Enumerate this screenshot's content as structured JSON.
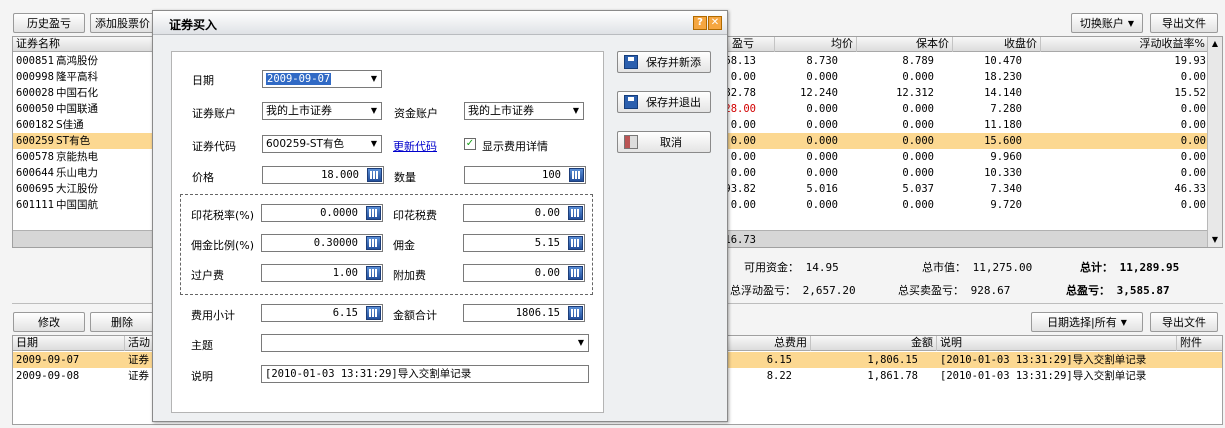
{
  "toolbar": {
    "history_btn": "历史盈亏",
    "add_stock_btn": "添加股票价",
    "switch_account_btn": "切换账户",
    "export_btn": "导出文件"
  },
  "holdings": {
    "columns": [
      "证券名称",
      "盈亏",
      "均价",
      "保本价",
      "收盘价",
      "浮动收益率%"
    ],
    "rows": [
      {
        "code": "000851",
        "name": "高鸿股份",
        "pl": "68.13",
        "avg": "8.730",
        "breakeven": "8.789",
        "close": "10.470",
        "ratio": "19.93",
        "selected": false,
        "negative": false
      },
      {
        "code": "000998",
        "name": "隆平高科",
        "pl": "0.00",
        "avg": "0.000",
        "breakeven": "0.000",
        "close": "18.230",
        "ratio": "0.00",
        "selected": false,
        "negative": false
      },
      {
        "code": "600028",
        "name": "中国石化",
        "pl": "82.78",
        "avg": "12.240",
        "breakeven": "12.312",
        "close": "14.140",
        "ratio": "15.52",
        "selected": false,
        "negative": false
      },
      {
        "code": "600050",
        "name": "中国联通",
        "pl": "28.00",
        "avg": "0.000",
        "breakeven": "0.000",
        "close": "7.280",
        "ratio": "0.00",
        "selected": false,
        "negative": true
      },
      {
        "code": "600182",
        "name": "S佳通",
        "pl": "0.00",
        "avg": "0.000",
        "breakeven": "0.000",
        "close": "11.180",
        "ratio": "0.00",
        "selected": false,
        "negative": false
      },
      {
        "code": "600259",
        "name": "ST有色",
        "pl": "0.00",
        "avg": "0.000",
        "breakeven": "0.000",
        "close": "15.600",
        "ratio": "0.00",
        "selected": true,
        "negative": false
      },
      {
        "code": "600578",
        "name": "京能热电",
        "pl": "0.00",
        "avg": "0.000",
        "breakeven": "0.000",
        "close": "9.960",
        "ratio": "0.00",
        "selected": false,
        "negative": false
      },
      {
        "code": "600644",
        "name": "乐山电力",
        "pl": "0.00",
        "avg": "0.000",
        "breakeven": "0.000",
        "close": "10.330",
        "ratio": "0.00",
        "selected": false,
        "negative": false
      },
      {
        "code": "600695",
        "name": "大江股份",
        "pl": "93.82",
        "avg": "5.016",
        "breakeven": "5.037",
        "close": "7.340",
        "ratio": "46.33",
        "selected": false,
        "negative": false
      },
      {
        "code": "601111",
        "name": "中国国航",
        "pl": "0.00",
        "avg": "0.000",
        "breakeven": "0.000",
        "close": "9.720",
        "ratio": "0.00",
        "selected": false,
        "negative": false
      }
    ],
    "footer_pl": "16.73"
  },
  "summary": {
    "available_label": "可用资金：",
    "available_value": "14.95",
    "market_value_label": "总市值：",
    "market_value_value": "11,275.00",
    "total_label": "总计：",
    "total_value": "11,289.95",
    "float_pl_label": "总浮动盈亏：",
    "float_pl_value": "2,657.20",
    "trade_pl_label": "总买卖盈亏：",
    "trade_pl_value": "928.67",
    "total_pl_label": "总盈亏：",
    "total_pl_value": "3,585.87"
  },
  "trade_toolbar": {
    "edit_btn": "修改",
    "delete_btn": "删除",
    "date_select_btn": "日期选择|所有",
    "export_btn": "导出文件"
  },
  "trades": {
    "columns": [
      "日期",
      "活动",
      "总费用",
      "金额",
      "说明",
      "附件"
    ],
    "rows": [
      {
        "date": "2009-09-07",
        "activity": "证券",
        "fee": "6.15",
        "amount": "1,806.15",
        "note": "[2010-01-03 13:31:29]导入交割单记录",
        "selected": true
      },
      {
        "date": "2009-09-08",
        "activity": "证券",
        "fee": "8.22",
        "amount": "1,861.78",
        "note": "[2010-01-03 13:31:29]导入交割单记录",
        "selected": false
      }
    ]
  },
  "dialog": {
    "title": "证券买入",
    "date_label": "日期",
    "date_value": "2009-09-07",
    "sec_account_label": "证券账户",
    "sec_account_value": "我的上市证券",
    "fund_account_label": "资金账户",
    "fund_account_value": "我的上市证券",
    "code_label": "证券代码",
    "code_value": "600259-ST有色",
    "update_code_link": "更新代码",
    "show_fee_label": "显示费用详情",
    "price_label": "价格",
    "price_value": "18.000",
    "qty_label": "数量",
    "qty_value": "100",
    "stamp_rate_label": "印花税率(%)",
    "stamp_rate_value": "0.0000",
    "stamp_fee_label": "印花税费",
    "stamp_fee_value": "0.00",
    "comm_rate_label": "佣金比例(%)",
    "comm_rate_value": "0.30000",
    "comm_label": "佣金",
    "comm_value": "5.15",
    "transfer_label": "过户费",
    "transfer_value": "1.00",
    "extra_label": "附加费",
    "extra_value": "0.00",
    "subtotal_label": "费用小计",
    "subtotal_value": "6.15",
    "amount_label": "金额合计",
    "amount_value": "1806.15",
    "topic_label": "主题",
    "topic_value": "",
    "note_label": "说明",
    "note_value": "[2010-01-03 13:31:29]导入交割单记录",
    "save_new_btn": "保存并新添",
    "save_exit_btn": "保存并退出",
    "cancel_btn": "取消"
  },
  "colors": {
    "selected_row": "#fcd891",
    "negative": "#d20000",
    "link": "#0000cc",
    "calc_icon": "#2b5fae"
  }
}
